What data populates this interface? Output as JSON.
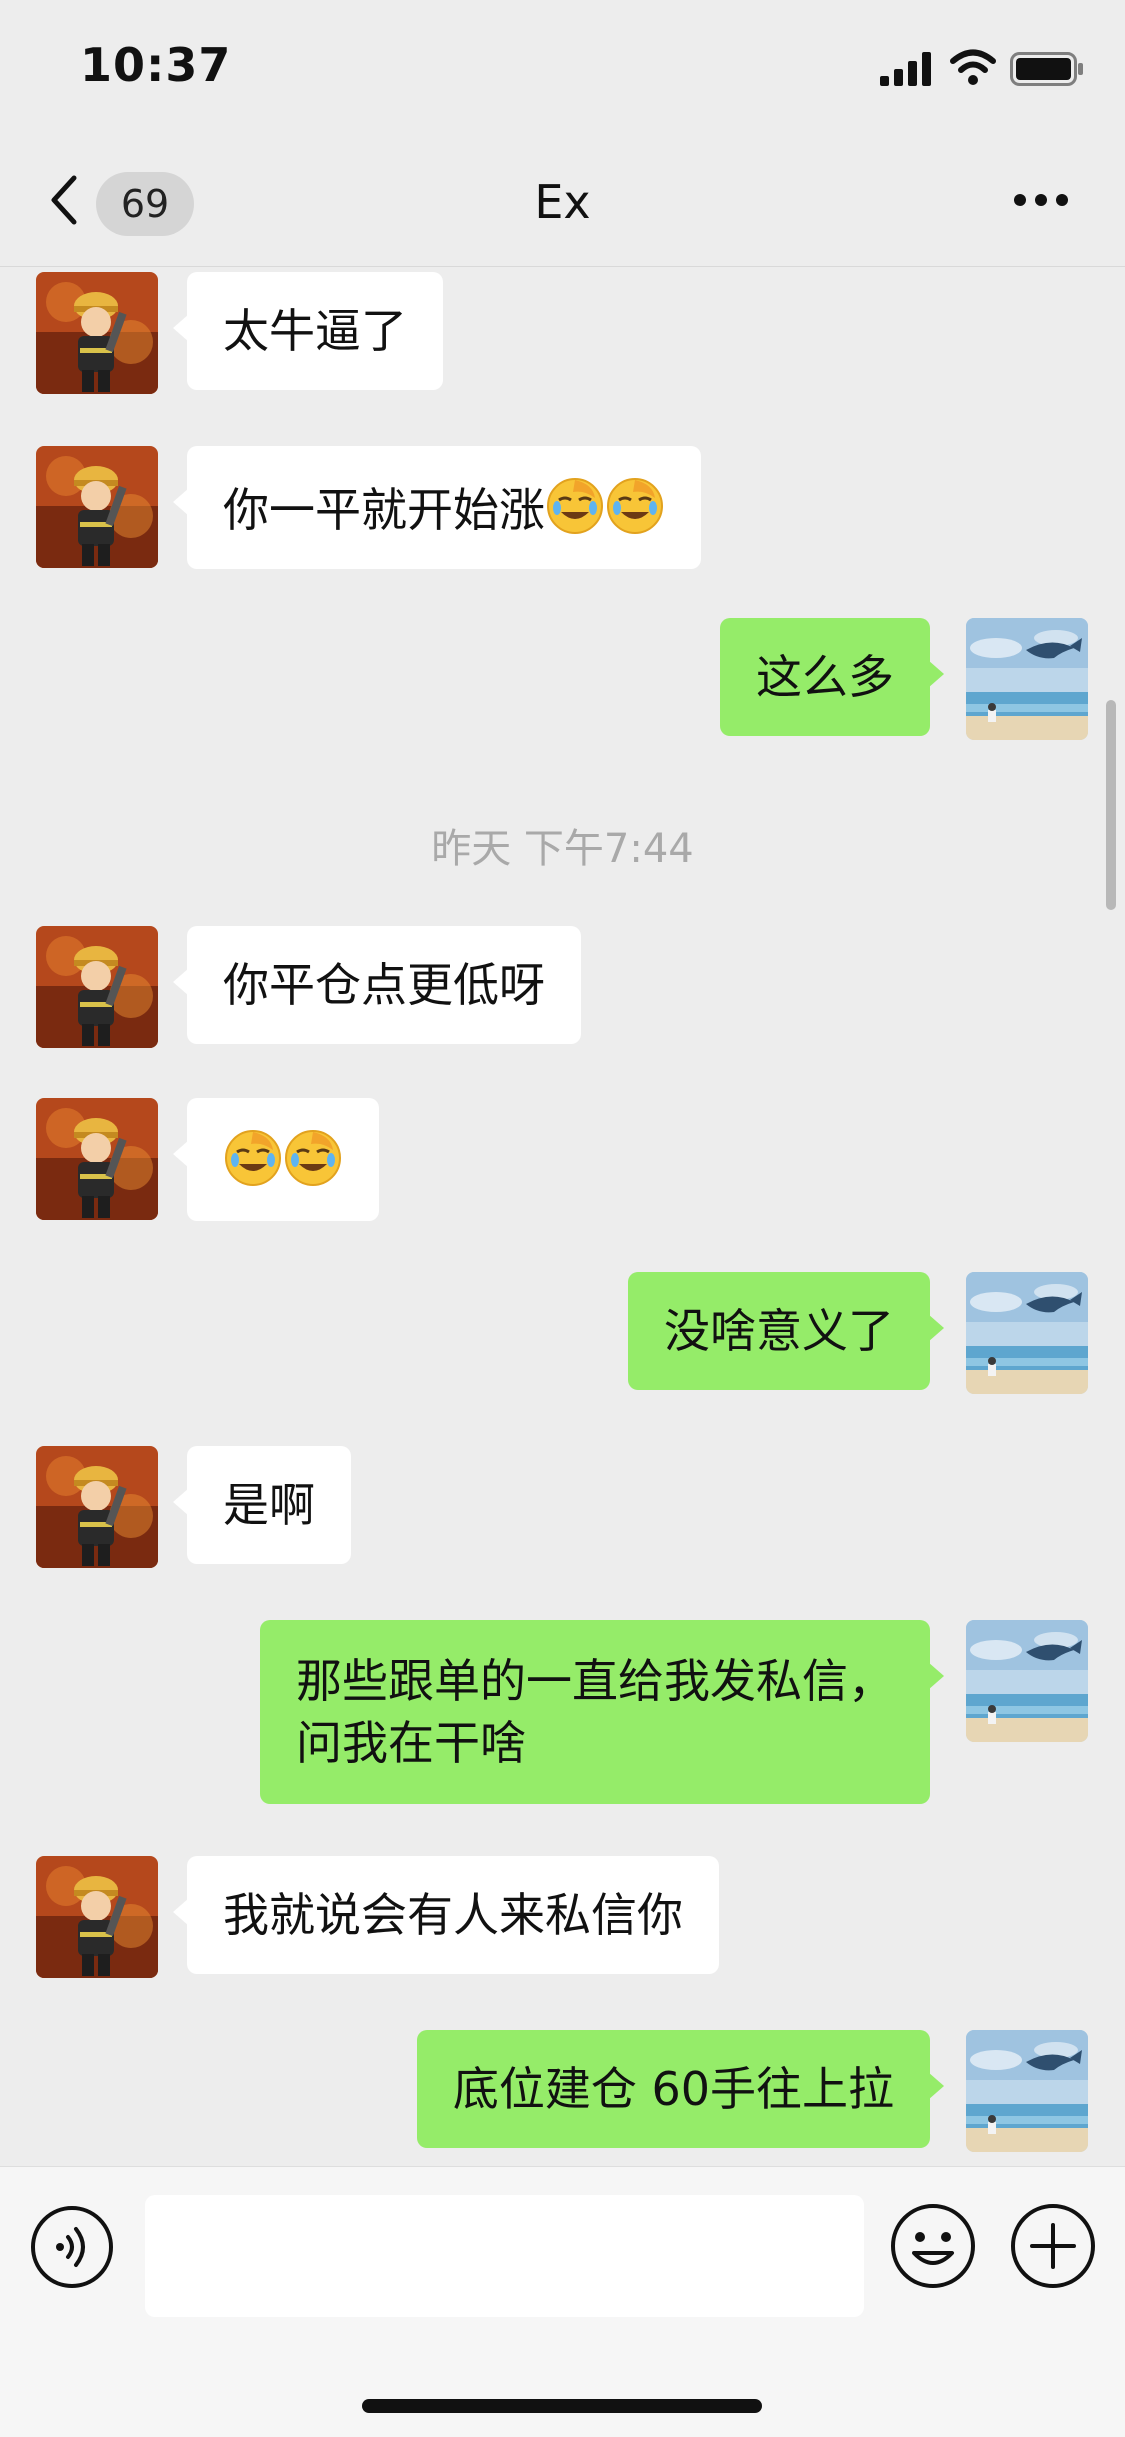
{
  "status_bar": {
    "time": "10:37"
  },
  "nav": {
    "unread_count": "69",
    "title": "Ex"
  },
  "messages": [
    {
      "side": "in",
      "text": "太牛逼了"
    },
    {
      "side": "in",
      "text": "你一平就开始涨",
      "emoji": [
        "facepalm-laugh",
        "facepalm-laugh"
      ]
    },
    {
      "side": "out",
      "text": "这么多"
    },
    {
      "type": "time",
      "text": "昨天 下午7:44"
    },
    {
      "side": "in",
      "text": "你平仓点更低呀"
    },
    {
      "side": "in",
      "text": "",
      "emoji": [
        "facepalm-laugh",
        "facepalm-laugh"
      ]
    },
    {
      "side": "out",
      "text": "没啥意义了"
    },
    {
      "side": "in",
      "text": "是啊"
    },
    {
      "side": "out",
      "text": "那些跟单的一直给我发私信，\n问我在干啥"
    },
    {
      "side": "in",
      "text": "我就说会有人来私信你"
    },
    {
      "side": "out",
      "text": "底位建仓 60手往上拉"
    }
  ],
  "input": {
    "placeholder": ""
  },
  "colors": {
    "out_bubble": "#95ec69",
    "in_bubble": "#ffffff",
    "background": "#ededed"
  },
  "icons": {
    "back": "chevron-left-icon",
    "more": "ellipsis-icon",
    "voice": "voice-icon",
    "emoji": "smiley-icon",
    "plus": "plus-icon",
    "contact_avatar": "firefighter-avatar",
    "my_avatar": "whale-sea-avatar"
  }
}
